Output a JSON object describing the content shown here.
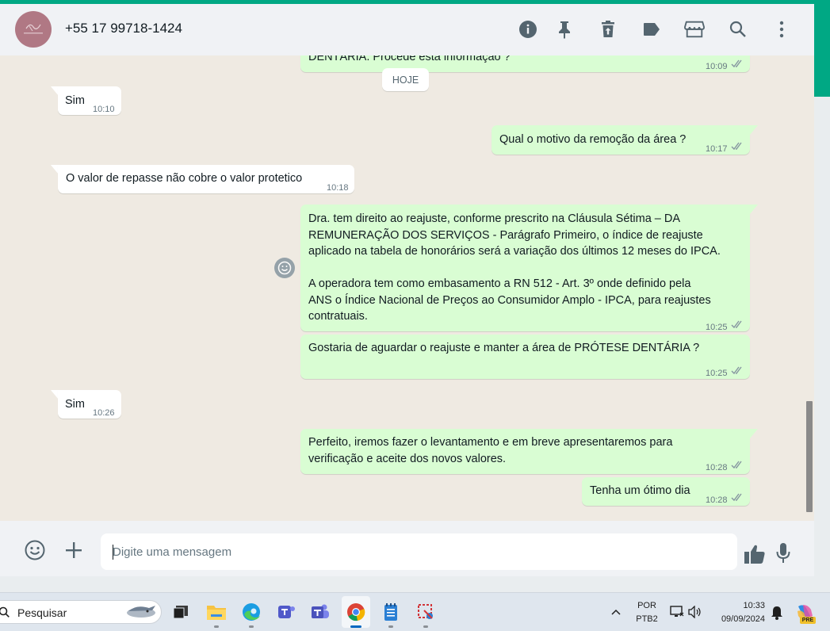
{
  "header": {
    "contact_name": "+55 17 99718-1424",
    "icons": [
      "info-icon",
      "pin-icon",
      "delete-icon",
      "label-icon",
      "catalog-icon",
      "search-icon",
      "menu-icon"
    ]
  },
  "chat": {
    "date_chip": "HOJE",
    "messages": [
      {
        "id": 0,
        "dir": "out",
        "text": "DENTÁRIA. Procede esta informação ?",
        "time": "10:09"
      },
      {
        "id": 1,
        "dir": "in",
        "text": "Sim",
        "time": "10:10"
      },
      {
        "id": 2,
        "dir": "out",
        "text": "Qual o motivo da remoção da área ?",
        "time": "10:17"
      },
      {
        "id": 3,
        "dir": "in",
        "text": "O valor de repasse não cobre o valor protetico",
        "time": "10:18"
      },
      {
        "id": 4,
        "dir": "out",
        "lines": [
          "Dra. tem direito ao reajuste, conforme prescrito na Cláusula Sétima – DA",
          "REMUNERAÇÃO DOS SERVIÇOS - Parágrafo Primeiro, o índice de reajuste",
          "aplicado na tabela de honorários será a variação dos últimos 12 meses do IPCA.",
          "",
          "A operadora tem como embasamento a RN 512 - Art. 3º onde definido pela",
          "ANS o Índice Nacional de Preços ao Consumidor Amplo - IPCA, para reajustes",
          "contratuais."
        ],
        "time": "10:25"
      },
      {
        "id": 5,
        "dir": "out",
        "text": "Gostaria de aguardar o reajuste e manter a área de PRÓTESE DENTÁRIA ?",
        "time": "10:25"
      },
      {
        "id": 6,
        "dir": "in",
        "text": "Sim",
        "time": "10:26"
      },
      {
        "id": 7,
        "dir": "out",
        "lines": [
          "Perfeito, iremos fazer o levantamento e em breve apresentaremos para",
          "verificação e aceite dos novos valores."
        ],
        "time": "10:28"
      },
      {
        "id": 8,
        "dir": "out",
        "text": "Tenha um ótimo dia",
        "time": "10:28"
      }
    ]
  },
  "composer": {
    "placeholder": "Digite uma mensagem"
  },
  "taskbar": {
    "search_label": "Pesquisar",
    "lang_top": "POR",
    "lang_bottom": "PTB2",
    "clock_time": "10:33",
    "clock_date": "09/09/2024",
    "copilot_badge": "PRE"
  },
  "colors": {
    "accent": "#00a884",
    "outgoing_bubble": "#d9fdd3",
    "incoming_bubble": "#ffffff",
    "chat_background": "#efeae2"
  }
}
